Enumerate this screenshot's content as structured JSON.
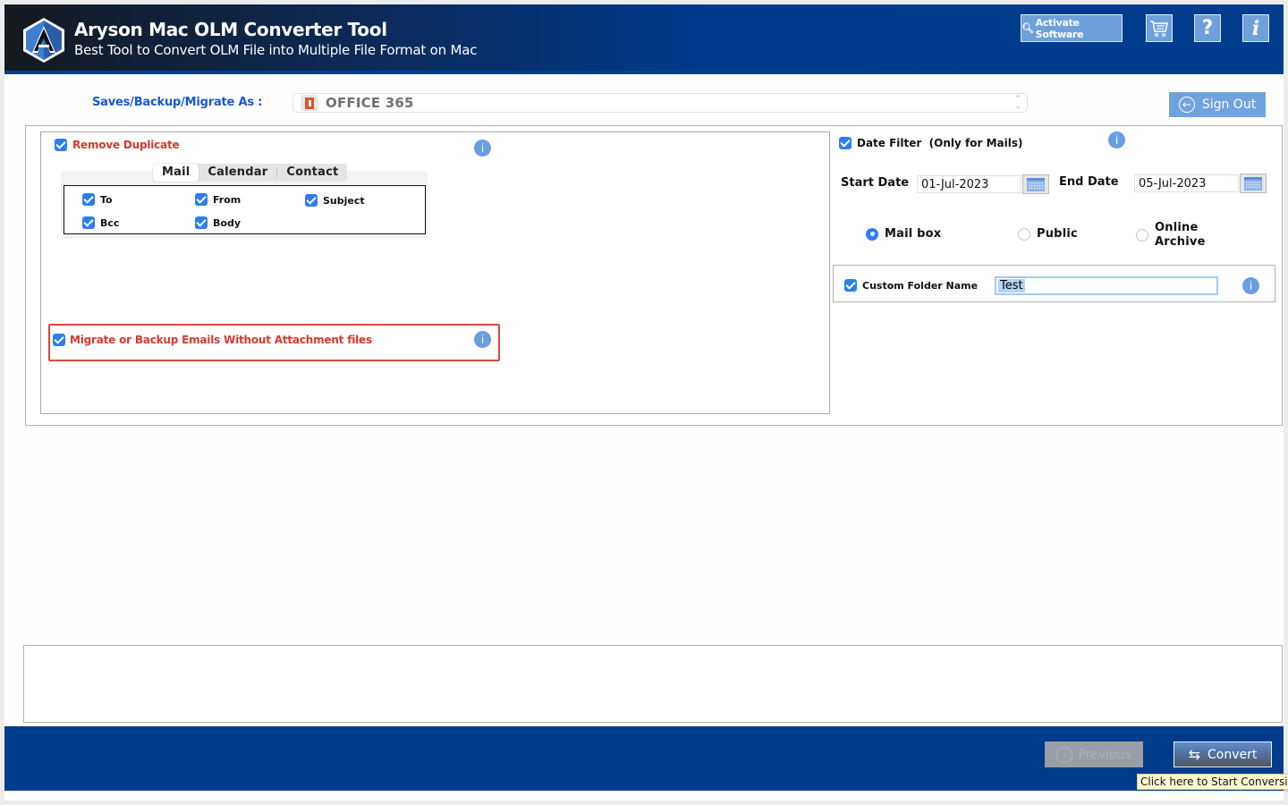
{
  "header": {
    "title": "Aryson Mac OLM Converter Tool",
    "subtitle": "Best Tool to Convert OLM File into Multiple File Format on Mac",
    "activate_label": "Activate Software",
    "cart_icon": "cart-icon",
    "help_glyph": "?",
    "info_glyph": "i"
  },
  "saves_row": {
    "label": "Saves/Backup/Migrate As :",
    "selected_format": "OFFICE 365",
    "sign_out_label": "Sign Out"
  },
  "remove_duplicate": {
    "label": "Remove Duplicate",
    "checked": true,
    "tabs": [
      {
        "label": "Mail",
        "active": true
      },
      {
        "label": "Calendar",
        "active": false
      },
      {
        "label": "Contact",
        "active": false
      }
    ],
    "fields": [
      {
        "label": "To",
        "checked": true
      },
      {
        "label": "From",
        "checked": true
      },
      {
        "label": "Subject",
        "checked": true
      },
      {
        "label": "Bcc",
        "checked": true
      },
      {
        "label": "Body",
        "checked": true
      }
    ],
    "info_glyph": "i"
  },
  "no_attachment": {
    "label": "Migrate or Backup Emails Without Attachment files",
    "checked": true,
    "info_glyph": "i"
  },
  "date_filter": {
    "label": "Date Filter  (Only for Mails)",
    "checked": true,
    "start_label": "Start Date",
    "start_value": "01-Jul-2023",
    "end_label": "End Date",
    "end_value": "05-Jul-2023",
    "info_glyph": "i"
  },
  "mailbox_type": {
    "options": [
      {
        "label": "Mail box",
        "selected": true
      },
      {
        "label": "Public",
        "selected": false
      },
      {
        "label_line1": "Online",
        "label_line2": "Archive",
        "selected": false
      }
    ]
  },
  "custom_folder": {
    "label": "Custom Folder Name",
    "checked": true,
    "value": "Test",
    "info_glyph": "i"
  },
  "footer": {
    "previous_label": "Previous",
    "convert_label": "Convert",
    "convert_tooltip": "Click here to Start Conversion."
  },
  "colors": {
    "header_blue": "#003c8c",
    "accent_blue": "#6ea0dc",
    "warning_red": "#d63a2f",
    "label_blue": "#1a56d6"
  }
}
